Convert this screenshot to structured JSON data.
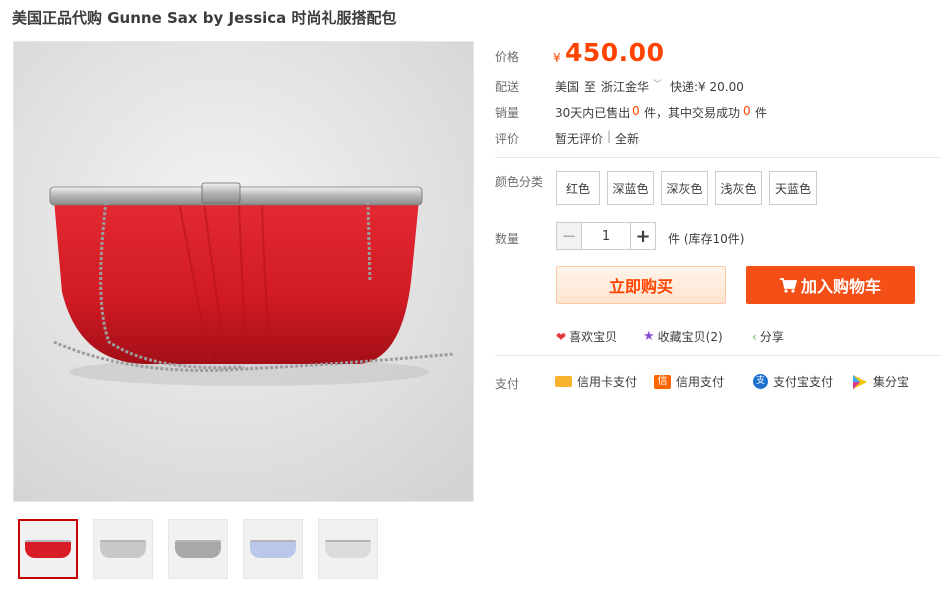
{
  "title": "美国正品代购 Gunne Sax by Jessica 时尚礼服搭配包",
  "labels": {
    "price": "价格",
    "delivery": "配送",
    "sales": "销量",
    "reviews": "评价",
    "color": "颜色分类",
    "quantity": "数量",
    "payment": "支付"
  },
  "price": {
    "symbol": "¥",
    "value": "450.00"
  },
  "delivery": {
    "from": "美国",
    "to_word": "至",
    "destination": "浙江金华",
    "shipping": "快递:¥ 20.00"
  },
  "sales": {
    "prefix": "30天内已售出",
    "sold": "0",
    "unit1": "件，其中交易成功",
    "success": "0",
    "unit2": "件"
  },
  "reviews": {
    "none": "暂无评价",
    "divider": "|",
    "new": "全新"
  },
  "colors": [
    "红色",
    "深蓝色",
    "深灰色",
    "浅灰色",
    "天蓝色"
  ],
  "quantity": {
    "minus": "−",
    "value": "1",
    "plus": "+",
    "stock": "件 (库存10件)"
  },
  "buttons": {
    "buy": "立即购买",
    "cart": "加入购物车"
  },
  "actions": {
    "like": "喜欢宝贝",
    "favorite": "收藏宝贝(2)",
    "share": "分享"
  },
  "payments": [
    "信用卡支付",
    "信用支付",
    "支付宝支付",
    "集分宝"
  ],
  "thumbnail_colors": [
    "#d81d27",
    "#c8c8c8",
    "#a8a8a8",
    "#b9c8ea",
    "#dcdcdc"
  ],
  "accent_color": "#ff4400"
}
